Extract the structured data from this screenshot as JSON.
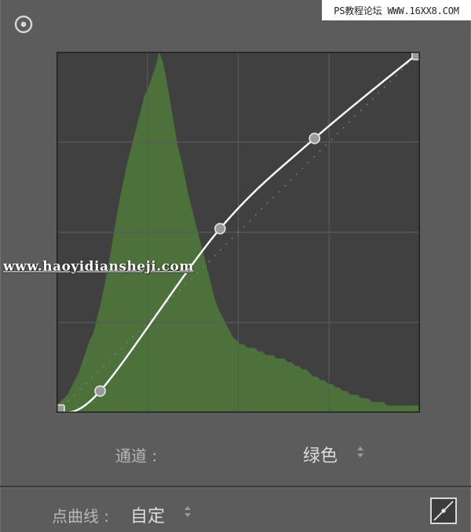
{
  "watermarks": {
    "top": "PS教程论坛 WWW.16XX8.COM",
    "middle": "www.haoyidiansheji.com"
  },
  "icons": {
    "target": "target-adjust-icon",
    "channel_arrows": "up-down-arrows-icon",
    "preset_arrows": "up-down-arrows-icon",
    "curve_button": "point-curve-edit-icon"
  },
  "channel": {
    "label": "通道 :",
    "value": "绿色"
  },
  "point_curve": {
    "label": "点曲线 :",
    "value": "自定"
  },
  "colors": {
    "panel_bg": "#5c5c5c",
    "graph_bg": "#404040",
    "histogram": "#4f7a3a",
    "curve": "#ffffff",
    "handle": "#9a9a9a"
  },
  "curve": {
    "points": [
      [
        0,
        0
      ],
      [
        12,
        6
      ],
      [
        45,
        51
      ],
      [
        71,
        76
      ],
      [
        100,
        100
      ]
    ]
  },
  "histogram": {
    "levels": [
      2,
      3,
      4,
      5,
      7,
      9,
      11,
      14,
      17,
      20,
      22,
      26,
      30,
      35,
      40,
      46,
      52,
      58,
      63,
      68,
      72,
      76,
      80,
      84,
      88,
      90,
      93,
      96,
      100,
      97,
      92,
      86,
      80,
      74,
      70,
      65,
      60,
      56,
      52,
      48,
      44,
      40,
      36,
      32,
      29,
      27,
      25,
      23,
      21,
      20,
      19,
      19,
      18,
      18,
      18,
      17,
      17,
      16,
      16,
      16,
      15,
      15,
      15,
      14,
      14,
      13,
      13,
      12,
      12,
      11,
      10,
      10,
      9,
      9,
      8,
      8,
      7,
      7,
      6,
      6,
      5,
      5,
      5,
      4,
      4,
      4,
      3,
      3,
      3,
      3,
      2,
      2,
      2,
      2,
      2,
      2,
      2,
      2,
      2,
      2
    ]
  }
}
